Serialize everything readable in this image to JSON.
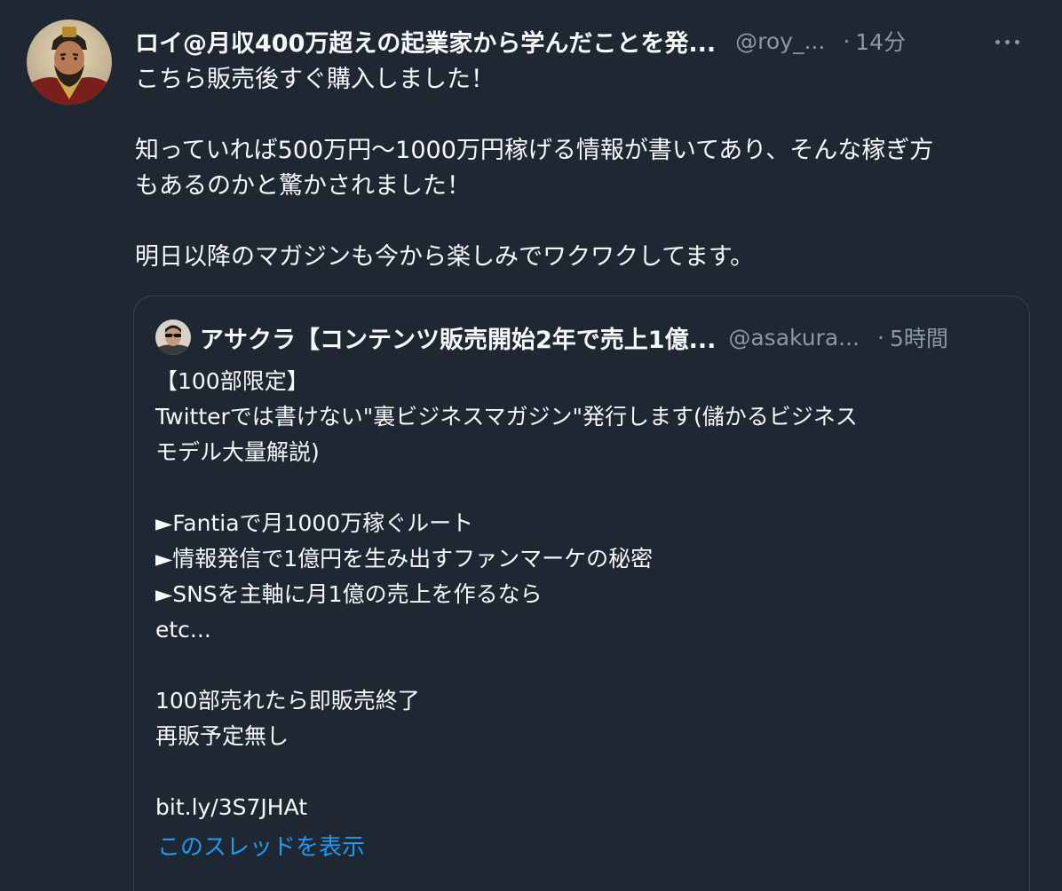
{
  "tweet": {
    "display_name": "ロイ@月収400万超えの起業家から学んだことを発...",
    "handle": "@roy_...",
    "separator": "·",
    "time": "14分",
    "body": [
      "こちら販売後すぐ購入しました！",
      "",
      "知っていれば500万円〜1000万円稼げる情報が書いてあり、そんな稼ぎ方",
      "もあるのかと驚かされました！",
      "",
      "明日以降のマガジンも今から楽しみでワクワクしてます。"
    ]
  },
  "quote": {
    "display_name": "アサクラ【コンテンツ販売開始2年で売上1億...",
    "handle": "@asakura...",
    "separator": "·",
    "time": "5時間",
    "body": [
      "【100部限定】",
      "Twitterでは書けない\"裏ビジネスマガジン\"発行します(儲かるビジネス",
      "モデル大量解説)",
      "",
      "►Fantiaで月1000万稼ぐルート",
      "►情報発信で1億円を生み出すファンマーケの秘密",
      "►SNSを主軸に月1億の売上を作るなら",
      "etc...",
      "",
      "100部売れたら即販売終了",
      "再販予定無し",
      "",
      "bit.ly/3S7JHAt"
    ],
    "show_thread_label": "このスレッドを表示"
  },
  "colors": {
    "background": "#1e2732",
    "text_primary": "#f7f9f9",
    "text_secondary": "#8b98a5",
    "link": "#1d9bf0",
    "border": "#38444d"
  },
  "icons": {
    "avatar": "samurai-portrait-avatar",
    "quote_avatar": "man-with-sunglasses-avatar",
    "more": "more-horizontal-icon"
  }
}
